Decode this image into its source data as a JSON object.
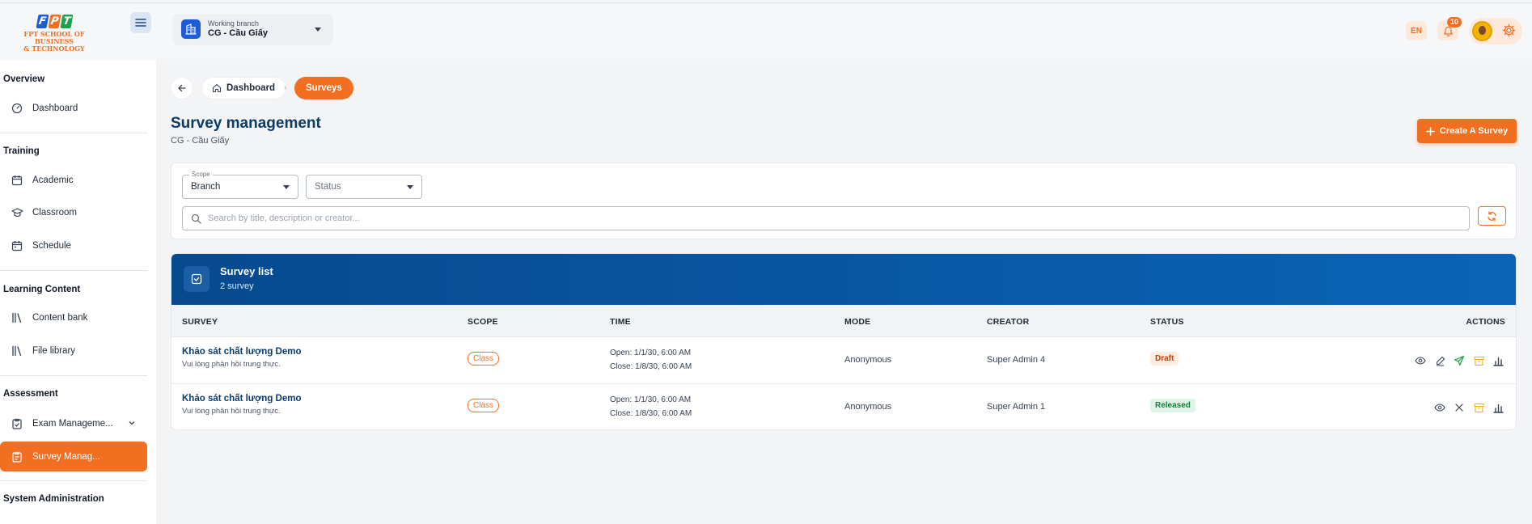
{
  "brand": {
    "logo_letters": [
      "F",
      "P",
      "T"
    ],
    "logo_colors": [
      "#1e5bd8",
      "#f26f21",
      "#1aa34a"
    ],
    "logo_line1": "FPT SCHOOL OF BUSINESS",
    "logo_line2": "& TECHNOLOGY"
  },
  "header": {
    "branch_caption": "Working branch",
    "branch_value": "CG - Cầu Giấy",
    "language": "EN",
    "notification_count": "10"
  },
  "sidebar": {
    "sections": [
      {
        "title": "Overview",
        "items": [
          {
            "label": "Dashboard",
            "icon": "gauge-icon"
          }
        ]
      },
      {
        "title": "Training",
        "items": [
          {
            "label": "Academic",
            "icon": "calendar-icon"
          },
          {
            "label": "Classroom",
            "icon": "graduation-cap-icon"
          },
          {
            "label": "Schedule",
            "icon": "calendar-icon"
          }
        ]
      },
      {
        "title": "Learning Content",
        "items": [
          {
            "label": "Content bank",
            "icon": "library-icon"
          },
          {
            "label": "File library",
            "icon": "library-icon"
          }
        ]
      },
      {
        "title": "Assessment",
        "items": [
          {
            "label": "Exam Manageme...",
            "icon": "clipboard-check-icon"
          },
          {
            "label": "Survey Manag...",
            "icon": "clipboard-list-icon",
            "active": true
          }
        ]
      },
      {
        "title": "System Administration",
        "items": []
      }
    ]
  },
  "breadcrumb": {
    "home_label": "Dashboard",
    "current_label": "Surveys"
  },
  "page": {
    "title": "Survey management",
    "subtitle": "CG - Cầu Giấy",
    "create_button": "Create A Survey"
  },
  "filters": {
    "scope_label": "Scope",
    "scope_value": "Branch",
    "status_placeholder": "Status",
    "search_placeholder": "Search by title, description or creator..."
  },
  "survey_list": {
    "title": "Survey list",
    "count_text": "2 survey",
    "columns": [
      "SURVEY",
      "SCOPE",
      "TIME",
      "MODE",
      "CREATOR",
      "STATUS",
      "ACTIONS"
    ],
    "rows": [
      {
        "title": "Khảo sát chất lượng Demo",
        "description": "Vui lòng phản hồi trung thực.",
        "scope": "Class",
        "open": "Open: 1/1/30, 6:00 AM",
        "close": "Close: 1/8/30, 6:00 AM",
        "mode": "Anonymous",
        "creator": "Super Admin 4",
        "status": "Draft",
        "actions": [
          "eye-icon",
          "edit-icon",
          "send-icon",
          "archive-icon",
          "bar-chart-icon"
        ]
      },
      {
        "title": "Khảo sát chất lượng Demo",
        "description": "Vui lòng phản hồi trung thực.",
        "scope": "Class",
        "open": "Open: 1/1/30, 6:00 AM",
        "close": "Close: 1/8/30, 6:00 AM",
        "mode": "Anonymous",
        "creator": "Super Admin 1",
        "status": "Released",
        "actions": [
          "eye-icon",
          "close-icon",
          "archive-icon",
          "bar-chart-icon"
        ]
      }
    ]
  },
  "colors": {
    "accent": "#f26f21",
    "primary_dark": "#0c3b66",
    "header_blue": "#064a8d",
    "draft": "#c2410c",
    "released": "#15803d"
  }
}
